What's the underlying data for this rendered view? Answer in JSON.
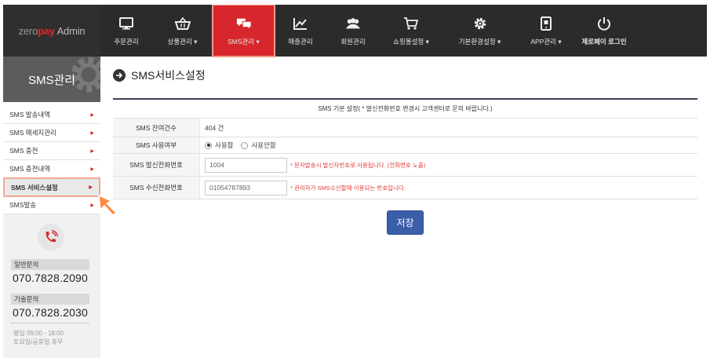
{
  "brand": {
    "zero": "zero",
    "pay": "pay",
    "admin": "Admin"
  },
  "nav": [
    {
      "label": "주문관리",
      "icon": "monitor-icon"
    },
    {
      "label": "상품관리 ▾",
      "icon": "basket-icon"
    },
    {
      "label": "SMS관리 ▾",
      "icon": "chat-icon",
      "active": true
    },
    {
      "label": "매출관리",
      "icon": "chart-icon"
    },
    {
      "label": "회원관리",
      "icon": "users-icon"
    },
    {
      "label": "쇼핑몰설정 ▾",
      "icon": "cart-icon"
    },
    {
      "label": "기본환경설정 ▾",
      "icon": "gear-icon"
    },
    {
      "label": "APP관리 ▾",
      "icon": "mobile-icon"
    },
    {
      "label": "제로페이 로그인",
      "icon": "power-icon"
    }
  ],
  "sidebar": {
    "title": "SMS관리",
    "items": [
      {
        "label": "SMS 발송내역"
      },
      {
        "label": "SMS 메세지관리"
      },
      {
        "label": "SMS 충전"
      },
      {
        "label": "SMS 충전내역"
      },
      {
        "label": "SMS 서비스설정",
        "active": true
      },
      {
        "label": "SMS발송"
      }
    ],
    "support": {
      "general_label": "일반문의",
      "general_phone": "070.7828.2090",
      "tech_label": "기술문의",
      "tech_phone": "070.7828.2030",
      "hours_line1": "평일 09:00 - 18:00",
      "hours_line2": "토요일/공휴일 휴무"
    }
  },
  "page": {
    "title": "SMS서비스설정",
    "section_header": "SMS 기본 설정( * 발신전화번호 변경시 고객센터로 문의 바랍니다.)",
    "rows": {
      "balance_label": "SMS 잔여건수",
      "balance_value": "404 건",
      "usage_label": "SMS 사용여부",
      "usage_on": "사용함",
      "usage_off": "사용안함",
      "sender_label": "SMS 발신전화번호",
      "sender_value": "1004",
      "sender_hint": "* 문자발송시 발신자번호로 사용됩니다. (전화번호 노출)",
      "receiver_label": "SMS 수신전화번호",
      "receiver_value": "01054787893",
      "receiver_hint": "* 관리자가 SMS수신할때 이용되는 번호입니다."
    },
    "save_label": "저장"
  },
  "colors": {
    "accent": "#d7272c",
    "nav_bg": "#2b2b2b",
    "button": "#3b5ea8",
    "table_top": "#3a3f55"
  }
}
